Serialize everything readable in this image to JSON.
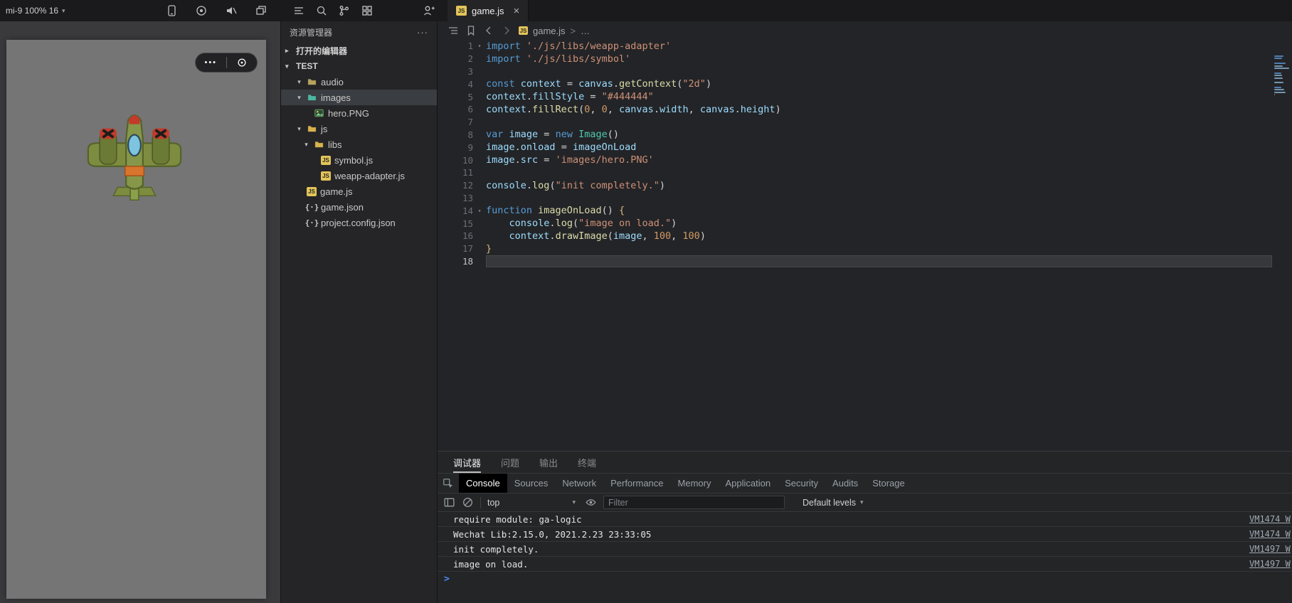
{
  "device_bar": {
    "label": "mi-9 100% 16"
  },
  "topbar": {
    "simulator_icons": [
      "phone-icon",
      "record-icon",
      "mute-icon",
      "cascade-windows-icon"
    ],
    "tool_icons": [
      "outline-list-icon",
      "search-icon",
      "branch-icon",
      "grid-icon"
    ],
    "right_icon": "add-user-icon"
  },
  "tab": {
    "label": "game.js",
    "icon": "js-file-icon",
    "close": "×"
  },
  "simulator": {
    "screen_color": "#757575",
    "capsule": {
      "dots": "•••",
      "indicator": "capsule-target-icon"
    },
    "sprite": "hero-plane"
  },
  "explorer": {
    "title": "资源管理器",
    "more": "···",
    "sections": [
      {
        "label": "打开的编辑器",
        "state": "collapsed"
      },
      {
        "label": "TEST",
        "state": "expanded"
      }
    ],
    "tree": [
      {
        "label": "audio",
        "kind": "folder",
        "depth": 1,
        "state": "expanded",
        "icon_color": "#b8a25c"
      },
      {
        "label": "images",
        "kind": "folder",
        "depth": 1,
        "state": "expanded",
        "selected": true,
        "icon_color": "#4db6a0"
      },
      {
        "label": "hero.PNG",
        "kind": "image",
        "depth": 2
      },
      {
        "label": "js",
        "kind": "folder",
        "depth": 1,
        "state": "expanded",
        "icon_color": "#d8b24a"
      },
      {
        "label": "libs",
        "kind": "folder",
        "depth": 2,
        "state": "expanded",
        "icon_color": "#d8b24a"
      },
      {
        "label": "symbol.js",
        "kind": "js",
        "depth": 3
      },
      {
        "label": "weapp-adapter.js",
        "kind": "js",
        "depth": 3
      },
      {
        "label": "game.js",
        "kind": "js",
        "depth": 1
      },
      {
        "label": "game.json",
        "kind": "json",
        "depth": 1
      },
      {
        "label": "project.config.json",
        "kind": "json",
        "depth": 1
      }
    ]
  },
  "editor": {
    "breadcrumb": {
      "file": "game.js",
      "sep": ">",
      "more": "…"
    },
    "code": {
      "current_line": 18,
      "folds": [
        1,
        14
      ],
      "lines": [
        [
          [
            "k",
            "import"
          ],
          [
            "o",
            " "
          ],
          [
            "s",
            "'./js/libs/weapp-adapter'"
          ]
        ],
        [
          [
            "k",
            "import"
          ],
          [
            "o",
            " "
          ],
          [
            "s",
            "'./js/libs/symbol'"
          ]
        ],
        [],
        [
          [
            "k",
            "const"
          ],
          [
            "o",
            " "
          ],
          [
            "v",
            "context"
          ],
          [
            "o",
            " = "
          ],
          [
            "v",
            "canvas"
          ],
          [
            "o",
            "."
          ],
          [
            "f",
            "getContext"
          ],
          [
            "o",
            "("
          ],
          [
            "s",
            "\"2d\""
          ],
          [
            "o",
            ")"
          ]
        ],
        [
          [
            "v",
            "context"
          ],
          [
            "o",
            "."
          ],
          [
            "p",
            "fillStyle"
          ],
          [
            "o",
            " = "
          ],
          [
            "s",
            "\"#444444\""
          ]
        ],
        [
          [
            "v",
            "context"
          ],
          [
            "o",
            "."
          ],
          [
            "f",
            "fillRect"
          ],
          [
            "o",
            "("
          ],
          [
            "n",
            "0"
          ],
          [
            "o",
            ", "
          ],
          [
            "n",
            "0"
          ],
          [
            "o",
            ", "
          ],
          [
            "v",
            "canvas"
          ],
          [
            "o",
            "."
          ],
          [
            "p",
            "width"
          ],
          [
            "o",
            ", "
          ],
          [
            "v",
            "canvas"
          ],
          [
            "o",
            "."
          ],
          [
            "p",
            "height"
          ],
          [
            "o",
            ")"
          ]
        ],
        [],
        [
          [
            "k",
            "var"
          ],
          [
            "o",
            " "
          ],
          [
            "v",
            "image"
          ],
          [
            "o",
            " = "
          ],
          [
            "k",
            "new"
          ],
          [
            "o",
            " "
          ],
          [
            "c",
            "Image"
          ],
          [
            "o",
            "()"
          ]
        ],
        [
          [
            "v",
            "image"
          ],
          [
            "o",
            "."
          ],
          [
            "p",
            "onload"
          ],
          [
            "o",
            " = "
          ],
          [
            "v",
            "imageOnLoad"
          ]
        ],
        [
          [
            "v",
            "image"
          ],
          [
            "o",
            "."
          ],
          [
            "p",
            "src"
          ],
          [
            "o",
            " = "
          ],
          [
            "s",
            "'images/hero.PNG'"
          ]
        ],
        [],
        [
          [
            "v",
            "console"
          ],
          [
            "o",
            "."
          ],
          [
            "f",
            "log"
          ],
          [
            "o",
            "("
          ],
          [
            "s",
            "\"init completely.\""
          ],
          [
            "o",
            ")"
          ]
        ],
        [],
        [
          [
            "k",
            "function"
          ],
          [
            "o",
            " "
          ],
          [
            "f",
            "imageOnLoad"
          ],
          [
            "o",
            "() "
          ],
          [
            "b",
            "{"
          ]
        ],
        [
          [
            "o",
            "    "
          ],
          [
            "v",
            "console"
          ],
          [
            "o",
            "."
          ],
          [
            "f",
            "log"
          ],
          [
            "o",
            "("
          ],
          [
            "s",
            "\"image on load.\""
          ],
          [
            "o",
            ")"
          ]
        ],
        [
          [
            "o",
            "    "
          ],
          [
            "v",
            "context"
          ],
          [
            "o",
            "."
          ],
          [
            "f",
            "drawImage"
          ],
          [
            "o",
            "("
          ],
          [
            "v",
            "image"
          ],
          [
            "o",
            ", "
          ],
          [
            "n",
            "100"
          ],
          [
            "o",
            ", "
          ],
          [
            "n",
            "100"
          ],
          [
            "o",
            ")"
          ]
        ],
        [
          [
            "b",
            "}"
          ]
        ],
        []
      ]
    }
  },
  "panel": {
    "tabs": [
      {
        "label": "调试器",
        "active": true
      },
      {
        "label": "问题"
      },
      {
        "label": "输出"
      },
      {
        "label": "终端"
      }
    ],
    "devtools_tabs": [
      {
        "label": "Console",
        "active": true
      },
      {
        "label": "Sources"
      },
      {
        "label": "Network"
      },
      {
        "label": "Performance"
      },
      {
        "label": "Memory"
      },
      {
        "label": "Application"
      },
      {
        "label": "Security"
      },
      {
        "label": "Audits"
      },
      {
        "label": "Storage"
      }
    ],
    "toolbar": {
      "context": "top",
      "filter_placeholder": "Filter",
      "levels": "Default levels"
    },
    "messages": [
      {
        "text": "require module: ga-logic",
        "source": "VM1474 W"
      },
      {
        "text": "Wechat Lib:2.15.0, 2021.2.23 23:33:05",
        "source": "VM1474 W"
      },
      {
        "text": "init completely.",
        "source": "VM1497 W"
      },
      {
        "text": "image on load.",
        "source": "VM1497 W"
      }
    ],
    "prompt": ">"
  }
}
